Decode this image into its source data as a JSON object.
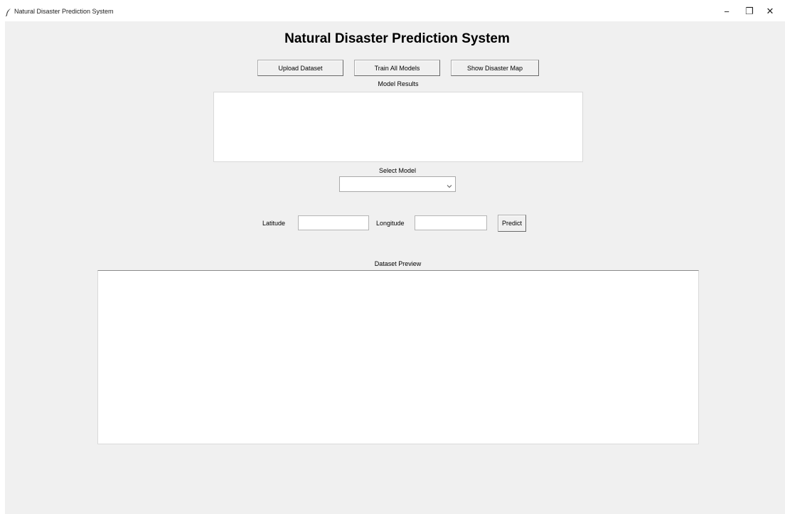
{
  "window": {
    "title": "Natural Disaster Prediction System",
    "controls": {
      "minimize": "−",
      "maximize": "❐",
      "close": "✕"
    }
  },
  "header": {
    "title": "Natural Disaster Prediction System"
  },
  "toolbar": {
    "upload_label": "Upload Dataset",
    "train_label": "Train All Models",
    "map_label": "Show Disaster Map"
  },
  "results": {
    "label": "Model Results",
    "content": ""
  },
  "model_select": {
    "label": "Select Model",
    "value": ""
  },
  "coordinates": {
    "latitude_label": "Latitude",
    "latitude_value": "",
    "longitude_label": "Longitude",
    "longitude_value": "",
    "predict_label": "Predict"
  },
  "preview": {
    "label": "Dataset Preview",
    "content": ""
  },
  "icons": {
    "app": "feather-icon",
    "dropdown": "chevron-down-icon"
  },
  "colors": {
    "window_background": "#f0f0f0",
    "field_background": "#ffffff"
  }
}
